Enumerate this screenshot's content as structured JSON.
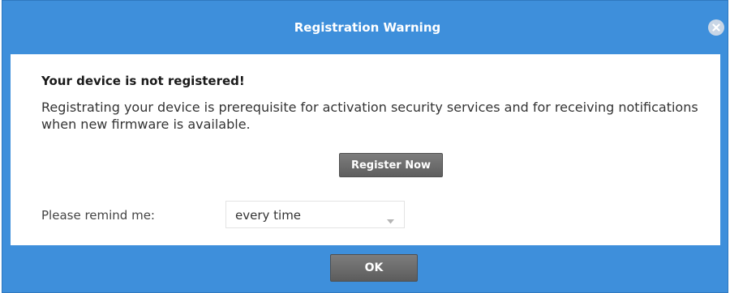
{
  "dialog": {
    "title": "Registration Warning",
    "close_icon": "close-icon",
    "heading": "Your device is not registered!",
    "message": "Registrating your device is prerequisite for activation security services and for receiving notifications when new firmware is available.",
    "register_button_label": "Register Now",
    "remind_label": "Please remind me:",
    "remind_selected": "every time",
    "ok_label": "OK"
  },
  "colors": {
    "title_bar": "#3e8fdb",
    "button": "#6e6e6e",
    "content_bg": "#ffffff"
  }
}
